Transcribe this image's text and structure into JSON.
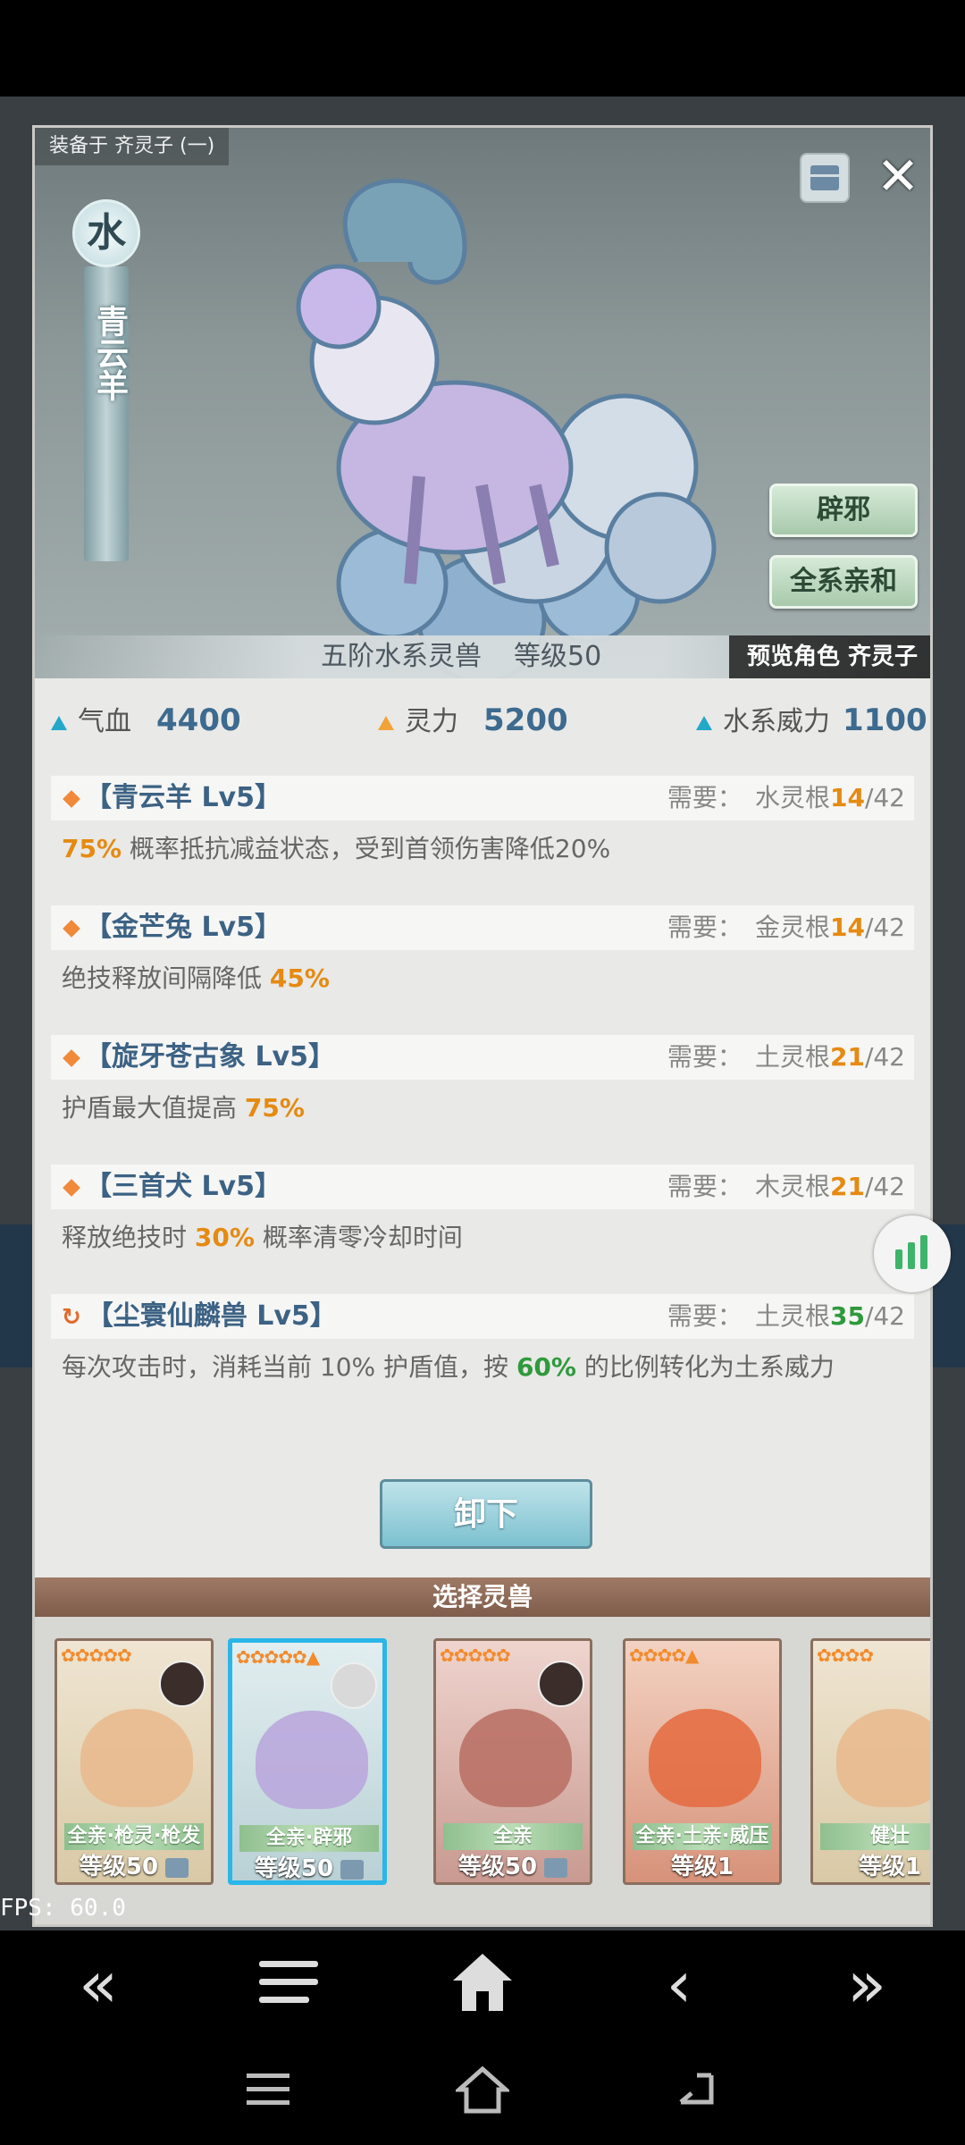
{
  "equip_label": "装备于 齐灵子 (一)",
  "element": "水",
  "beast_name": "青云羊",
  "tags": [
    "辟邪",
    "全系亲和"
  ],
  "tier": "五阶水系灵兽",
  "level": "等级50",
  "preview": "预览角色 齐灵子",
  "stats": [
    {
      "label": "气血",
      "value": "4400"
    },
    {
      "label": "灵力",
      "value": "5200"
    },
    {
      "label": "水系威力",
      "value": "1100"
    }
  ],
  "skills": [
    {
      "name": "【青云羊 Lv5】",
      "req_label": "需要：",
      "req_root": "水灵根",
      "req_cur": "14",
      "req_max": "/42",
      "desc_a": "75%",
      "desc_b": " 概率抵抗减益状态，受到首领伤害降低20%",
      "desc_c": ""
    },
    {
      "name": "【金芒兔 Lv5】",
      "req_label": "需要：",
      "req_root": "金灵根",
      "req_cur": "14",
      "req_max": "/42",
      "desc_a": "",
      "desc_b": "绝技释放间隔降低 ",
      "desc_c": "45%"
    },
    {
      "name": "【旋牙苍古象 Lv5】",
      "req_label": "需要：",
      "req_root": "土灵根",
      "req_cur": "21",
      "req_max": "/42",
      "desc_a": "",
      "desc_b": "护盾最大值提高 ",
      "desc_c": "75%"
    },
    {
      "name": "【三首犬 Lv5】",
      "req_label": "需要：",
      "req_root": "木灵根",
      "req_cur": "21",
      "req_max": "/42",
      "desc_a": "",
      "desc_b": "释放绝技时 ",
      "desc_c": "30%",
      "desc_d": " 概率清零冷却时间"
    },
    {
      "name": "【尘寰仙麟兽 Lv5】",
      "req_label": "需要：",
      "req_root": "土灵根",
      "req_cur": "35",
      "req_max": "/42",
      "desc_b": "每次攻击时，消耗当前 10% 护盾值，按 ",
      "desc_c": "60%",
      "desc_d": " 的比例转化为土系威力"
    }
  ],
  "unequip": "卸下",
  "select_title": "选择灵兽",
  "cards": [
    {
      "trait": "全亲·枪灵·枪发",
      "level": "等级50"
    },
    {
      "trait": "全亲·辟邪",
      "level": "等级50"
    },
    {
      "trait": "全亲",
      "level": "等级50"
    },
    {
      "trait": "全亲·土亲·威压",
      "level": "等级1"
    },
    {
      "trait": "健壮",
      "level": "等级1"
    }
  ],
  "fps": "FPS: 60.0",
  "colors": {
    "accent": "#2ab6e8",
    "stat_value": "#3d6a8f",
    "highlight": "#e58a12",
    "success": "#2f9a3c"
  }
}
